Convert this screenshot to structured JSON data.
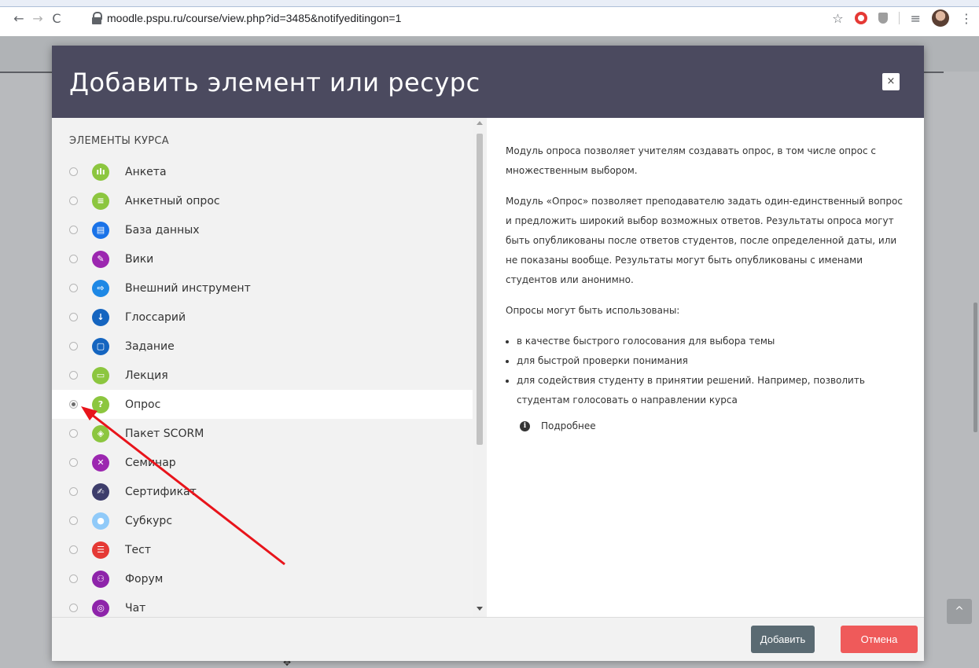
{
  "browser": {
    "url": "moodle.pspu.ru/course/view.php?id=3485&notifyeditingon=1",
    "back_icon": "←",
    "forward_icon": "→",
    "reload_icon": "C",
    "star_icon": "☆",
    "menu_icon": "⋮",
    "media_icon": "≡"
  },
  "modal": {
    "title": "Добавить элемент или ресурс",
    "close_icon": "×",
    "section_heading": "ЭЛЕМЕНТЫ КУРСА",
    "items": [
      {
        "label": "Анкета",
        "color": "#8cc63f",
        "glyph": "ılı",
        "selected": false
      },
      {
        "label": "Анкетный опрос",
        "color": "#8cc63f",
        "glyph": "≡",
        "selected": false
      },
      {
        "label": "База данных",
        "color": "#1a73e8",
        "glyph": "▤",
        "selected": false
      },
      {
        "label": "Вики",
        "color": "#9c27b0",
        "glyph": "✎",
        "selected": false
      },
      {
        "label": "Внешний инструмент",
        "color": "#1e88e5",
        "glyph": "⇨",
        "selected": false
      },
      {
        "label": "Глоссарий",
        "color": "#1565c0",
        "glyph": "↓",
        "selected": false
      },
      {
        "label": "Задание",
        "color": "#1565c0",
        "glyph": "▢",
        "selected": false
      },
      {
        "label": "Лекция",
        "color": "#8cc63f",
        "glyph": "▭",
        "selected": false
      },
      {
        "label": "Опрос",
        "color": "#8cc63f",
        "glyph": "?",
        "selected": true
      },
      {
        "label": "Пакет SCORM",
        "color": "#8cc63f",
        "glyph": "◈",
        "selected": false
      },
      {
        "label": "Семинар",
        "color": "#9c27b0",
        "glyph": "✕",
        "selected": false
      },
      {
        "label": "Сертификат",
        "color": "#3d3d6b",
        "glyph": "✍",
        "selected": false
      },
      {
        "label": "Субкурс",
        "color": "#90caf9",
        "glyph": "●",
        "selected": false
      },
      {
        "label": "Тест",
        "color": "#e53935",
        "glyph": "☰",
        "selected": false
      },
      {
        "label": "Форум",
        "color": "#8e24aa",
        "glyph": "⚇",
        "selected": false
      },
      {
        "label": "Чат",
        "color": "#8e24aa",
        "glyph": "◎",
        "selected": false
      }
    ],
    "description": {
      "p1": "Модуль опроса позволяет учителям создавать опрос, в том числе опрос с множественным выбором.",
      "p2": "Модуль «Опрос» позволяет преподавателю задать один-единственный вопрос и предложить широкий выбор возможных ответов. Результаты опроса могут быть опубликованы после ответов студентов, после определенной даты, или не показаны вообще. Результаты могут быть опубликованы с именами студентов или анонимно.",
      "p3": "Опросы могут быть использованы:",
      "bullets": [
        "в качестве быстрого голосования для выбора темы",
        "для быстрой проверки понимания",
        "для содействия студенту в принятии решений. Например, позволить студентам голосовать о направлении курса"
      ],
      "more_link": "Подробнее",
      "info_icon": "i"
    },
    "add_button": "Добавить",
    "cancel_button": "Отмена"
  },
  "page": {
    "scroll_top_icon": "^",
    "move_icon": "✥"
  },
  "colors": {
    "header_bg": "#4b4a5f",
    "add_btn": "#5a6a72",
    "cancel_btn": "#ef5a5a",
    "annotation_arrow": "#e8141b"
  }
}
